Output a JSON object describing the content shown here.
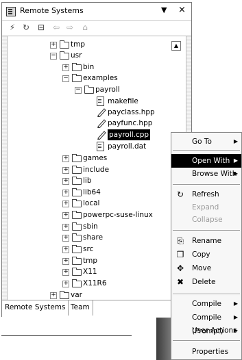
{
  "view": {
    "title": "Remote Systems",
    "menu_glyph": "▼",
    "close_glyph": "×"
  },
  "toolbar": {
    "icons": [
      "connect-icon",
      "refresh-icon",
      "collapse-all-icon",
      "back-icon",
      "forward-icon",
      "home-icon"
    ]
  },
  "tree": {
    "nodes": [
      {
        "label": "tmp",
        "type": "folder",
        "expander": "+"
      },
      {
        "label": "usr",
        "type": "folder",
        "expander": "−"
      },
      {
        "label": "bin",
        "type": "folder",
        "expander": "+"
      },
      {
        "label": "examples",
        "type": "folder",
        "expander": "−"
      },
      {
        "label": "payroll",
        "type": "folder",
        "expander": "−"
      },
      {
        "label": "makefile",
        "type": "file"
      },
      {
        "label": "payclass.hpp",
        "type": "cpp"
      },
      {
        "label": "payfunc.hpp",
        "type": "cpp"
      },
      {
        "label": "payroll.cpp",
        "type": "cpp",
        "selected": true
      },
      {
        "label": "payroll.dat",
        "type": "file"
      },
      {
        "label": "games",
        "type": "folder",
        "expander": "+"
      },
      {
        "label": "include",
        "type": "folder",
        "expander": "+"
      },
      {
        "label": "lib",
        "type": "folder",
        "expander": "+"
      },
      {
        "label": "lib64",
        "type": "folder",
        "expander": "+"
      },
      {
        "label": "local",
        "type": "folder",
        "expander": "+"
      },
      {
        "label": "powerpc-suse-linux",
        "type": "folder",
        "expander": "+"
      },
      {
        "label": "sbin",
        "type": "folder",
        "expander": "+"
      },
      {
        "label": "share",
        "type": "folder",
        "expander": "+"
      },
      {
        "label": "src",
        "type": "folder",
        "expander": "+"
      },
      {
        "label": "tmp",
        "type": "folder",
        "expander": "+"
      },
      {
        "label": "X11",
        "type": "folder",
        "expander": "+"
      },
      {
        "label": "X11R6",
        "type": "folder",
        "expander": "+"
      },
      {
        "label": "var",
        "type": "folder",
        "expander": "+"
      }
    ]
  },
  "tabs": [
    "Remote Systems",
    "Team"
  ],
  "context_menu": {
    "items": [
      {
        "label": "Go To",
        "submenu": true
      },
      {
        "label": "Open With",
        "submenu": true,
        "active": true
      },
      {
        "label": "Browse With",
        "submenu": true
      },
      {
        "label": "Refresh",
        "icon": "refresh-icon"
      },
      {
        "label": "Expand",
        "disabled": true
      },
      {
        "label": "Collapse",
        "disabled": true
      },
      {
        "label": "Rename",
        "icon": "rename-icon"
      },
      {
        "label": "Copy",
        "icon": "copy-icon"
      },
      {
        "label": "Move",
        "icon": "move-icon"
      },
      {
        "label": "Delete",
        "icon": "delete-icon"
      },
      {
        "label": "Compile",
        "submenu": true
      },
      {
        "label": "Compile (Prompt)",
        "submenu": true
      },
      {
        "label": "User Actions",
        "submenu": true
      },
      {
        "label": "Properties"
      }
    ]
  }
}
